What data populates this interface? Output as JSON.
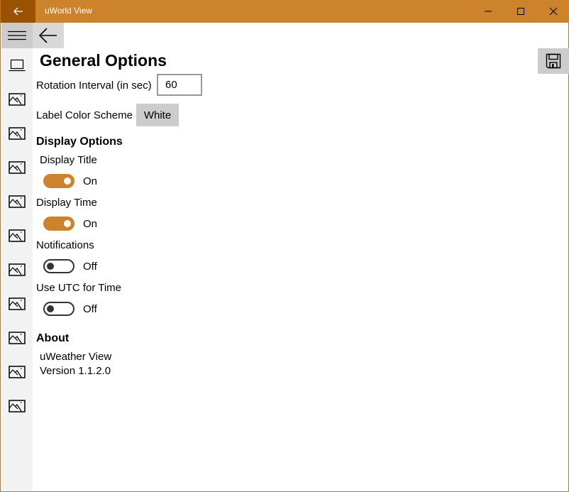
{
  "window": {
    "title": "uWorld View",
    "accent_color": "#cd822c",
    "back_button_color": "#9a5200",
    "controls": [
      "minimize-icon",
      "maximize-icon",
      "close-icon"
    ]
  },
  "nav": {
    "items": [
      {
        "icon": "laptop-icon"
      },
      {
        "icon": "image-icon"
      },
      {
        "icon": "image-icon"
      },
      {
        "icon": "image-icon"
      },
      {
        "icon": "image-icon"
      },
      {
        "icon": "image-icon"
      },
      {
        "icon": "image-icon"
      },
      {
        "icon": "image-icon"
      },
      {
        "icon": "image-icon"
      },
      {
        "icon": "image-icon"
      },
      {
        "icon": "image-icon"
      }
    ]
  },
  "page": {
    "title": "General Options",
    "rotation_label": "Rotation Interval (in sec)",
    "rotation_value": "60",
    "color_scheme_label": "Label Color Scheme",
    "color_scheme_value": "White",
    "display_options_heading": "Display Options",
    "toggles": [
      {
        "label": "Display Title",
        "state": "On",
        "on": true
      },
      {
        "label": "Display Time",
        "state": "On",
        "on": true
      },
      {
        "label": "Notifications",
        "state": "Off",
        "on": false
      },
      {
        "label": "Use UTC for Time",
        "state": "Off",
        "on": false
      }
    ],
    "about_heading": "About",
    "app_name": "uWeather View",
    "version": "Version 1.1.2.0"
  }
}
